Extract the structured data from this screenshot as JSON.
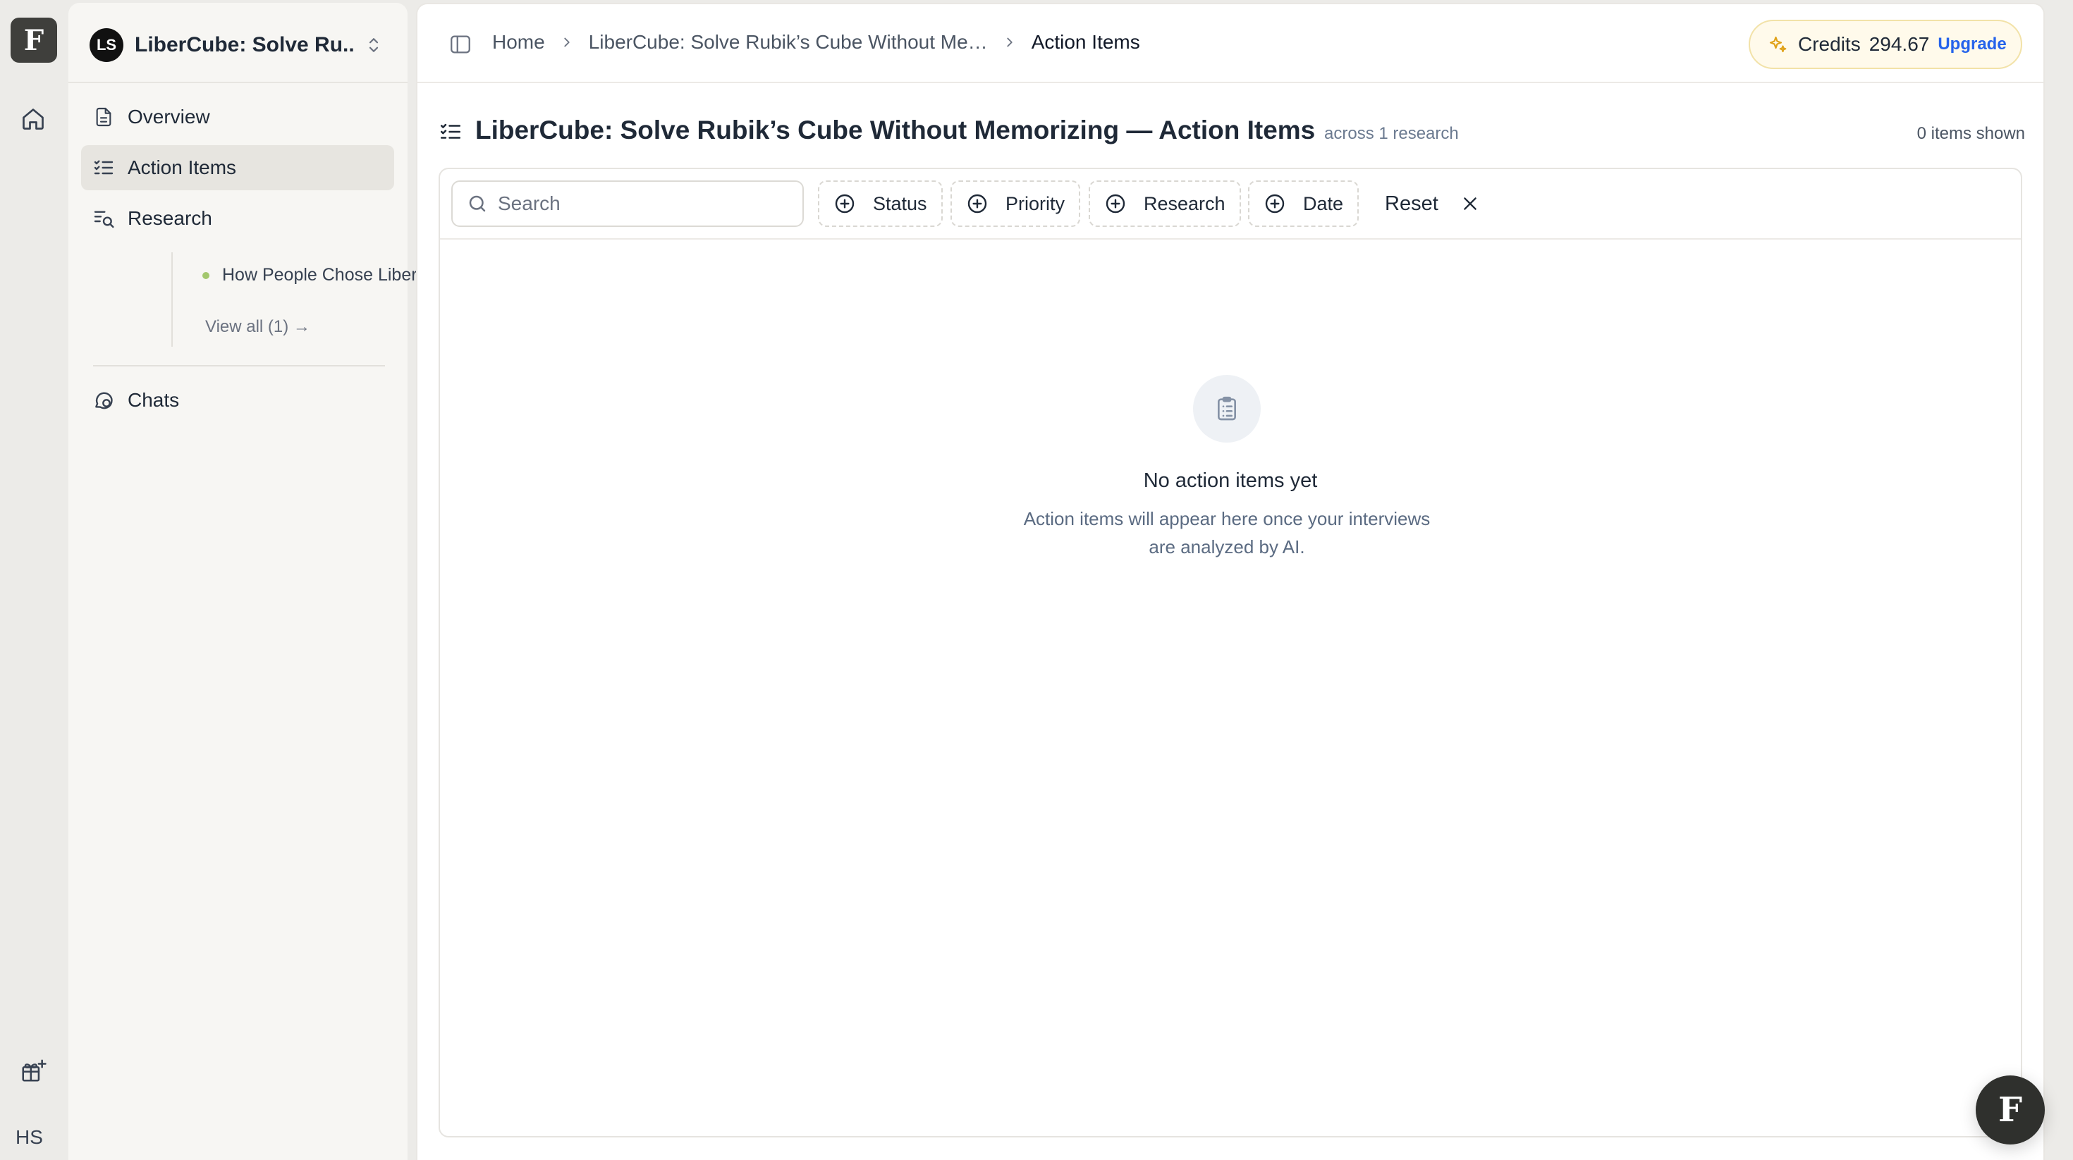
{
  "rail": {
    "logo": "F",
    "user_initials": "HS"
  },
  "project": {
    "badge": "LS",
    "name": "LiberCube: Solve Ru..."
  },
  "sidebar": {
    "items": [
      {
        "label": "Overview",
        "icon": "document-icon"
      },
      {
        "label": "Action Items",
        "icon": "checklist-icon"
      },
      {
        "label": "Research",
        "icon": "research-icon"
      },
      {
        "label": "Chats",
        "icon": "chat-icon"
      }
    ],
    "research_child": "How People Chose LiberCube",
    "view_all": "View all (1) →"
  },
  "breadcrumb": {
    "home": "Home",
    "project": "LiberCube: Solve Rubik’s Cube Without Me…",
    "current": "Action Items"
  },
  "credits": {
    "label": "Credits",
    "value": "294.67",
    "upgrade": "Upgrade"
  },
  "page": {
    "title": "LiberCube: Solve Rubik’s Cube Without Memorizing — Action Items",
    "subtitle": "across 1 research",
    "count": "0 items shown"
  },
  "filters": {
    "search_placeholder": "Search",
    "chips": [
      "Status",
      "Priority",
      "Research",
      "Date"
    ],
    "reset": "Reset"
  },
  "empty_state": {
    "title": "No action items yet",
    "description": "Action items will appear here once your interviews are analyzed by AI."
  },
  "fab_label": "F",
  "colors": {
    "accent_blue": "#2563eb",
    "credits_bg": "#fffaeb",
    "research_dot": "#a3c76d",
    "logo_bg": "#3f3f3c"
  }
}
